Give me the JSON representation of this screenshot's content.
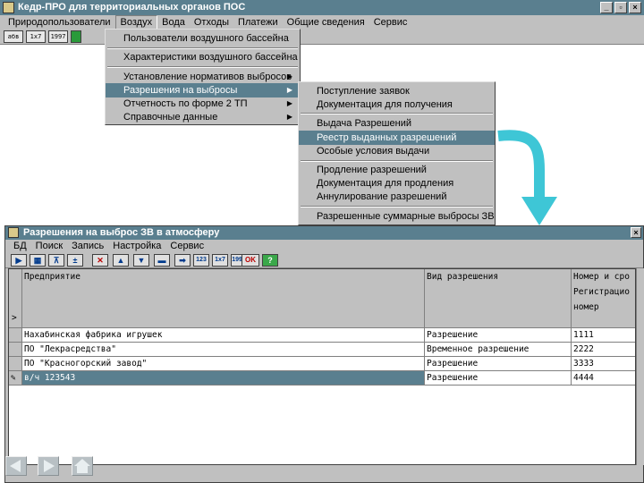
{
  "app": {
    "title": "Кедр-ПРО для территориальных органов ПОС",
    "menu": [
      "Природопользователи",
      "Воздух",
      "Вода",
      "Отходы",
      "Платежи",
      "Общие сведения",
      "Сервис"
    ],
    "toolbar": [
      "абв",
      "1x7",
      "1997"
    ]
  },
  "menu_air": {
    "items": [
      "Пользователи воздушного бассейна",
      "Характеристики воздушного бассейна",
      "Установление нормативов выбросов",
      "Разрешения на выбросы",
      "Отчетность по форме 2 ТП",
      "Справочные данные"
    ]
  },
  "submenu_permits": {
    "items": [
      "Поступление заявок",
      "Документация для получения",
      "Выдача Разрешений",
      "Реестр выданных разрешений",
      "Особые условия выдачи",
      "Продление разрешений",
      "Документация для продления",
      "Аннулирование разрешений",
      "Разрешенные суммарные выбросы ЗВ"
    ]
  },
  "inner_window": {
    "title": "Разрешения на выброс ЗВ в атмосферу",
    "menu": [
      "БД",
      "Поиск",
      "Запись",
      "Настройка",
      "Сервис"
    ],
    "toolbar_labels": {
      "b1": "123",
      "b2": "1x7",
      "b3": "1997",
      "ok": "OK",
      "help": "?"
    }
  },
  "table": {
    "headers": {
      "c1": "Предприятие",
      "c2": "Вид разрешения",
      "c3a": "Номер и сро",
      "c3b": "Регистрацио",
      "c3c": "номер",
      "marker": ">"
    },
    "rows": [
      {
        "enterprise": "Нахабинская фабрика игрушек",
        "type": "Разрешение",
        "number": "1111"
      },
      {
        "enterprise": "ПО \"Лекрасредства\"",
        "type": "Временное разрешение",
        "number": "2222"
      },
      {
        "enterprise": "ПО \"Красногорский завод\"",
        "type": "Разрешение",
        "number": "3333"
      },
      {
        "enterprise": "в/ч 123543",
        "type": "Разрешение",
        "number": "4444"
      }
    ]
  },
  "colors": {
    "titlebar": "#5a7f8f",
    "arrow": "#3ec6d6",
    "face": "#c0c0c0"
  }
}
